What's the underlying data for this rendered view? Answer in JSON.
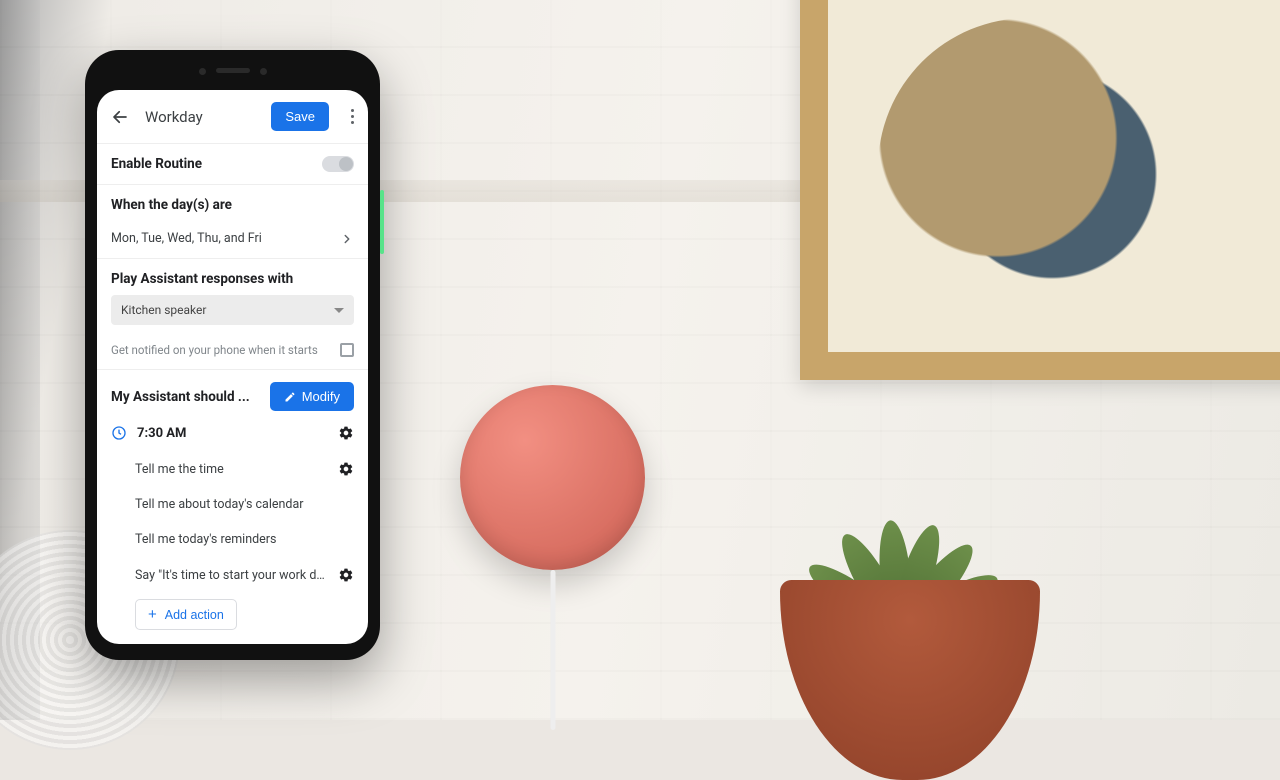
{
  "appbar": {
    "title": "Workday",
    "save": "Save"
  },
  "enable": {
    "label": "Enable Routine"
  },
  "days": {
    "header": "When the day(s) are",
    "value": "Mon, Tue, Wed, Thu, and Fri"
  },
  "responses": {
    "header": "Play Assistant responses with",
    "selected": "Kitchen speaker",
    "notify": "Get notified on your phone when it starts"
  },
  "assistant": {
    "header": "My Assistant should ...",
    "modify": "Modify",
    "time": "7:30 AM",
    "actions": [
      {
        "text": "Tell me the time",
        "gear": true
      },
      {
        "text": "Tell me about today's calendar",
        "gear": false
      },
      {
        "text": "Tell me today's reminders",
        "gear": false
      },
      {
        "text": "Say \"It's time to start your work day. H...",
        "gear": true
      }
    ],
    "add": "Add action"
  }
}
